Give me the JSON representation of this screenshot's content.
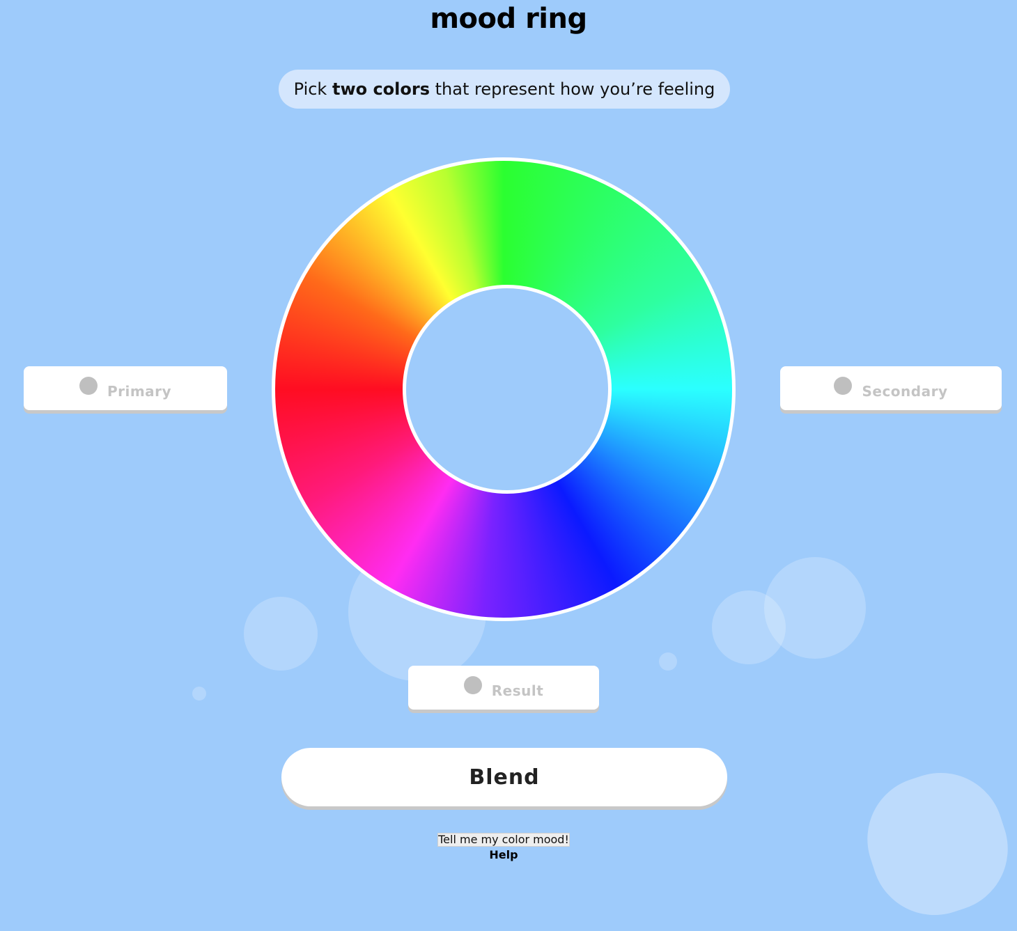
{
  "app": {
    "title": "mood ring"
  },
  "instruction": {
    "prefix": "Pick ",
    "emphasis": "two colors",
    "suffix": " that represent how you’re feeling"
  },
  "wheel": {
    "colors": [
      "#2bff30",
      "#2bffff",
      "#0b1aff",
      "#ff2cf2",
      "#ff0d22",
      "#ffff30"
    ]
  },
  "swatches": {
    "primary": {
      "label": "Primary",
      "color": "#bfbfbf"
    },
    "secondary": {
      "label": "Secondary",
      "color": "#bfbfbf"
    },
    "result": {
      "label": "Result",
      "color": "#bfbfbf"
    }
  },
  "actions": {
    "blend_label": "Blend",
    "mood_label": "Tell me my color mood!",
    "help_label": "Help"
  },
  "colors": {
    "background": "#9ecbfb",
    "card": "#ffffff",
    "placeholder": "#bfbfbf"
  }
}
